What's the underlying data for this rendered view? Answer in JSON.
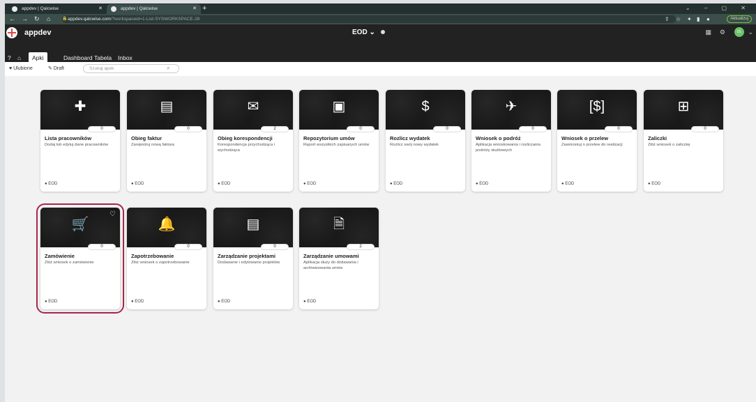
{
  "tabs": [
    {
      "title": "appdev | Qalcwise",
      "active": false
    },
    {
      "title": "appdev | Qalcwise",
      "active": true
    }
  ],
  "address": {
    "host": "appdev.qalcwise.com",
    "path": "/?workspaceid=1-List-SYSWORKSPACE-28"
  },
  "browser": {
    "update_label": "Aktualizuj"
  },
  "app": {
    "name": "appdev",
    "workspace": "EOD ⌄",
    "avatar": "OL"
  },
  "menu": [
    {
      "label": "Apki",
      "active": true
    },
    {
      "label": "Dashboard",
      "active": false
    },
    {
      "label": "Tabela",
      "active": false
    },
    {
      "label": "Inbox",
      "active": false
    }
  ],
  "filters": {
    "favorites": "Ulubione",
    "draft": "Draft",
    "search_placeholder": "Szukaj apek"
  },
  "cards": [
    {
      "title": "Lista pracowników",
      "desc": "Dodaj lub edytuj dane pracowników",
      "count": "0",
      "tag": "EOD",
      "icon": "+👤"
    },
    {
      "title": "Obieg faktur",
      "desc": "Zarejestruj nową fakturę",
      "count": "0",
      "tag": "EOD",
      "icon": "📋"
    },
    {
      "title": "Obieg korespondencji",
      "desc": "Korespondencja przychodząca i wychodząca",
      "count": "2",
      "tag": "EOD",
      "icon": "✉"
    },
    {
      "title": "Repozytorium umów",
      "desc": "Raport wszystkich zapisanych umów",
      "count": "0",
      "tag": "EOD",
      "icon": "▣"
    },
    {
      "title": "Rozlicz wydatek",
      "desc": "Rozlicz swój nowy wydatek",
      "count": "0",
      "tag": "EOD",
      "icon": "$"
    },
    {
      "title": "Wniosek o podróż",
      "desc": "Aplikacja wnioskowania i rozliczania podróży służbowych",
      "count": "0",
      "tag": "EOD",
      "icon": "✈"
    },
    {
      "title": "Wniosek o przelew",
      "desc": "Zawnioskuj o przelew do realizacji",
      "count": "0",
      "tag": "EOD",
      "icon": "[$]"
    },
    {
      "title": "Zaliczki",
      "desc": "Złóż wniosek o zaliczkę",
      "count": "0",
      "tag": "EOD",
      "icon": "⊞"
    },
    {
      "title": "Zamówienie",
      "desc": "Złóż wniosek o zamówienie",
      "count": "0",
      "tag": "EOD",
      "icon": "🛒",
      "selected": true
    },
    {
      "title": "Zapotrzebowanie",
      "desc": "Złóż wniosek o zapotrzebowanie",
      "count": "0",
      "tag": "EOD",
      "icon": "🔔"
    },
    {
      "title": "Zarządzanie projektami",
      "desc": "Dodawanie i edytowanie projektów",
      "count": "0",
      "tag": "EOD",
      "icon": "▤"
    },
    {
      "title": "Zarządzanie umowami",
      "desc": "Aplikacja służy do dodawania i archiwizowania umów",
      "count": "2",
      "tag": "EOD",
      "icon": "🗎"
    }
  ]
}
